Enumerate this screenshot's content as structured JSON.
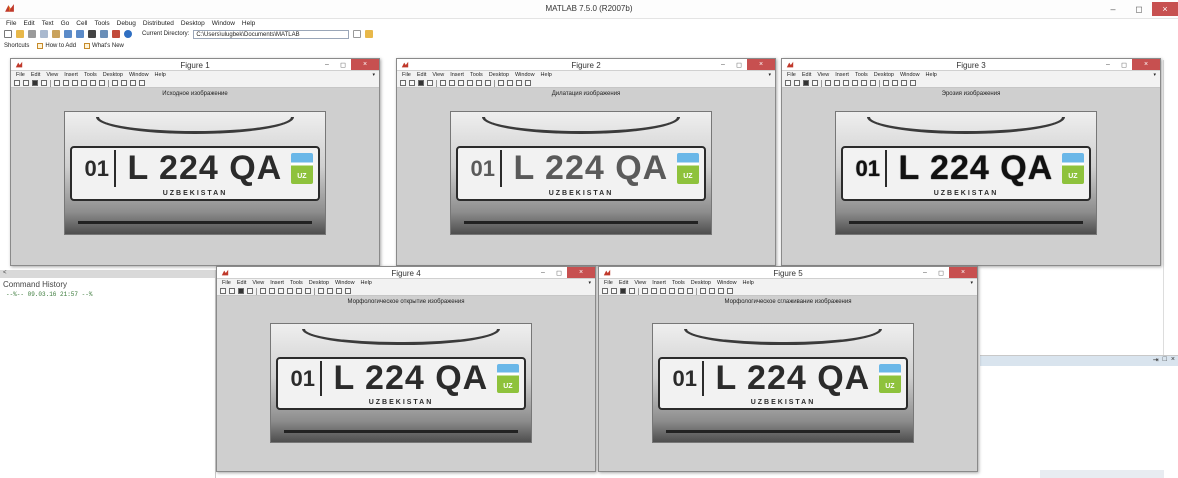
{
  "main_window": {
    "title": "MATLAB 7.5.0 (R2007b)",
    "menu": [
      "File",
      "Edit",
      "Text",
      "Go",
      "Cell",
      "Tools",
      "Debug",
      "Distributed",
      "Desktop",
      "Window",
      "Help"
    ],
    "current_directory_label": "Current Directory:",
    "current_directory_value": "C:\\Users\\ulugbek\\Documents\\MATLAB",
    "shortcuts": [
      "Shortcuts",
      "How to Add",
      "What's New"
    ],
    "window_controls": [
      "–",
      "◻",
      "×"
    ]
  },
  "command_history": {
    "title": "Command History",
    "entries": [
      "--%-- 09.03.16 21:57 --%"
    ]
  },
  "figure_menu": [
    "File",
    "Edit",
    "View",
    "Insert",
    "Tools",
    "Desktop",
    "Window",
    "Help"
  ],
  "figures": [
    {
      "title": "Figure 1",
      "axes_title": "Исходное изображение"
    },
    {
      "title": "Figure 2",
      "axes_title": "Дилатация изображения"
    },
    {
      "title": "Figure 3",
      "axes_title": "Эрозия изображения"
    },
    {
      "title": "Figure 4",
      "axes_title": "Морфологическое открытие изображения"
    },
    {
      "title": "Figure 5",
      "axes_title": "Морфологическое сглаживание изображения"
    }
  ],
  "plate": {
    "region": "01",
    "number": "L 224 QA",
    "flag_text": "UZ",
    "country": "UZBEKISTAN"
  },
  "colors": {
    "close_button": "#c75050",
    "figure_background": "#cfcfcf",
    "history_text": "#3a7a3a"
  },
  "icons": [
    "matlab-logo-icon",
    "new-file-icon",
    "open-file-icon",
    "save-icon",
    "print-icon",
    "zoom-in-icon",
    "zoom-out-icon",
    "pan-icon",
    "rotate-icon",
    "data-cursor-icon",
    "colorbar-icon",
    "legend-icon"
  ]
}
